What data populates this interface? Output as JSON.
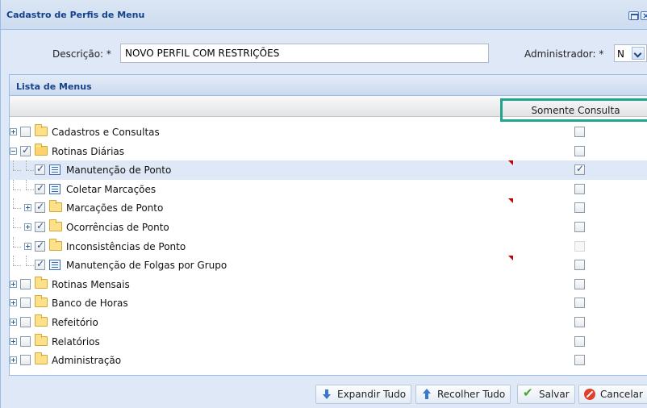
{
  "window": {
    "title": "Cadastro de Perfis de Menu",
    "accent_color": "#15428b",
    "highlight_color": "#1fa58d"
  },
  "form": {
    "descricao_label": "Descrição: *",
    "descricao_value": "NOVO PERFIL COM RESTRIÇÕES",
    "administrador_label": "Administrador: *",
    "administrador_value": "N"
  },
  "panel": {
    "title": "Lista de Menus",
    "column_somente_consulta": "Somente Consulta"
  },
  "tree": [
    {
      "label": "Cadastros e Consultas",
      "level": 0,
      "type": "folder",
      "expanded": false,
      "checked": false,
      "somente_consulta": false,
      "selected": false,
      "dirty": false
    },
    {
      "label": "Rotinas Diárias",
      "level": 0,
      "type": "folder",
      "expanded": true,
      "checked": true,
      "somente_consulta": false,
      "selected": false,
      "dirty": false
    },
    {
      "label": "Manutenção de Ponto",
      "level": 1,
      "type": "leaf",
      "expanded": null,
      "checked": true,
      "somente_consulta": true,
      "selected": true,
      "dirty": true
    },
    {
      "label": "Coletar Marcações",
      "level": 1,
      "type": "leaf",
      "expanded": null,
      "checked": true,
      "somente_consulta": false,
      "selected": false,
      "dirty": false
    },
    {
      "label": "Marcações de Ponto",
      "level": 1,
      "type": "folder",
      "expanded": false,
      "checked": true,
      "somente_consulta": false,
      "selected": false,
      "dirty": true
    },
    {
      "label": "Ocorrências de Ponto",
      "level": 1,
      "type": "folder",
      "expanded": false,
      "checked": true,
      "somente_consulta": false,
      "selected": false,
      "dirty": false
    },
    {
      "label": "Inconsistências de Ponto",
      "level": 1,
      "type": "folder",
      "expanded": false,
      "checked": true,
      "somente_consulta": false,
      "disabled_consulta": true,
      "selected": false,
      "dirty": false
    },
    {
      "label": "Manutenção de Folgas por Grupo",
      "level": 1,
      "type": "leaf",
      "expanded": null,
      "checked": true,
      "somente_consulta": false,
      "selected": false,
      "dirty": true
    },
    {
      "label": "Rotinas Mensais",
      "level": 0,
      "type": "folder",
      "expanded": false,
      "checked": false,
      "somente_consulta": false,
      "selected": false,
      "dirty": false
    },
    {
      "label": "Banco de Horas",
      "level": 0,
      "type": "folder",
      "expanded": false,
      "checked": false,
      "somente_consulta": false,
      "selected": false,
      "dirty": false
    },
    {
      "label": "Refeitório",
      "level": 0,
      "type": "folder",
      "expanded": false,
      "checked": false,
      "somente_consulta": false,
      "selected": false,
      "dirty": false
    },
    {
      "label": "Relatórios",
      "level": 0,
      "type": "folder",
      "expanded": false,
      "checked": false,
      "somente_consulta": false,
      "selected": false,
      "dirty": false
    },
    {
      "label": "Administração",
      "level": 0,
      "type": "folder",
      "expanded": false,
      "checked": false,
      "somente_consulta": false,
      "selected": false,
      "dirty": false
    }
  ],
  "footer": {
    "expandir_label": "Expandir Tudo",
    "recolher_label": "Recolher Tudo",
    "salvar_label": "Salvar",
    "cancelar_label": "Cancelar"
  }
}
